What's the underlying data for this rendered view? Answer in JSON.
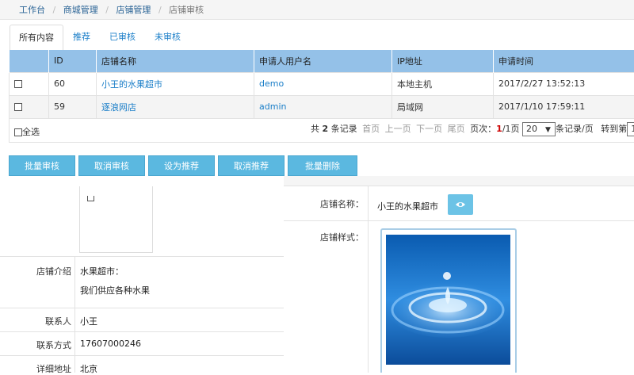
{
  "breadcrumb": {
    "items": [
      "工作台",
      "商城管理",
      "店铺管理"
    ],
    "current": "店铺审核"
  },
  "tabs": [
    {
      "label": "所有内容",
      "active": true
    },
    {
      "label": "推荐",
      "active": false
    },
    {
      "label": "已审核",
      "active": false
    },
    {
      "label": "未审核",
      "active": false
    }
  ],
  "table": {
    "headers": [
      "ID",
      "店铺名称",
      "申请人用户名",
      "IP地址",
      "申请时间"
    ],
    "rows": [
      {
        "id": "60",
        "shop_name": "小王的水果超市",
        "username": "demo",
        "ip": "本地主机",
        "time": "2017/2/27 13:52:13"
      },
      {
        "id": "59",
        "shop_name": "逐浪网店",
        "username": "admin",
        "ip": "局域网",
        "time": "2017/1/10 17:59:11"
      }
    ]
  },
  "footer": {
    "select_all": "全选",
    "total_prefix": "共",
    "total_count": "2",
    "total_suffix": "条记录",
    "first": "首页",
    "prev": "上一页",
    "next": "下一页",
    "last": "尾页",
    "page_label": "页次：",
    "page_current": "1",
    "page_total": "/1页",
    "page_size": "20",
    "per_page_label": "条记录/页",
    "goto_label": "转到第",
    "goto_value": "1"
  },
  "actions": [
    "批量审核",
    "取消审核",
    "设为推荐",
    "取消推荐",
    "批量删除"
  ],
  "detail_left": {
    "intro_label": "店铺介绍",
    "intro_line1": "水果超市：",
    "intro_line2": "我们供应各种水果",
    "contact_label": "联系人",
    "contact_value": "小王",
    "phone_label": "联系方式",
    "phone_value": "17607000246",
    "address_label": "详细地址",
    "address_value": "北京"
  },
  "detail_right": {
    "name_label": "店铺名称：",
    "name_value": "小王的水果超市",
    "style_label": "店铺样式：",
    "eye_icon": "eye-icon"
  },
  "colors": {
    "header_bg": "#94c1e8",
    "button_bg": "#5bb8e0",
    "link": "#1a7ec8",
    "page_current": "#cc0000"
  }
}
